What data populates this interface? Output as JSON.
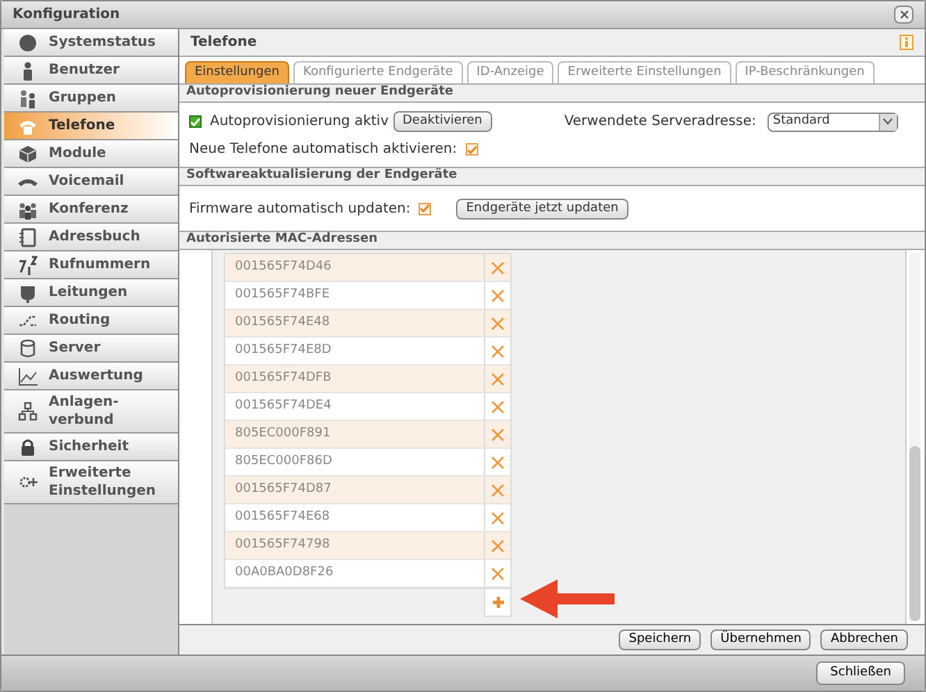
{
  "window": {
    "title": "Konfiguration"
  },
  "sidebar": {
    "items": [
      {
        "label": "Systemstatus",
        "selected": false
      },
      {
        "label": "Benutzer",
        "selected": false
      },
      {
        "label": "Gruppen",
        "selected": false
      },
      {
        "label": "Telefone",
        "selected": true
      },
      {
        "label": "Module",
        "selected": false
      },
      {
        "label": "Voicemail",
        "selected": false
      },
      {
        "label": "Konferenz",
        "selected": false
      },
      {
        "label": "Adressbuch",
        "selected": false
      },
      {
        "label": "Rufnummern",
        "selected": false
      },
      {
        "label": "Leitungen",
        "selected": false
      },
      {
        "label": "Routing",
        "selected": false
      },
      {
        "label": "Server",
        "selected": false
      },
      {
        "label": "Auswertung",
        "selected": false
      },
      {
        "label": "Anlagen-\nverbund",
        "selected": false
      },
      {
        "label": "Sicherheit",
        "selected": false
      },
      {
        "label": "Erweiterte\nEinstellungen",
        "selected": false
      }
    ]
  },
  "panel": {
    "title": "Telefone"
  },
  "tabs": [
    {
      "label": "Einstellungen",
      "selected": true
    },
    {
      "label": "Konfigurierte Endgeräte",
      "selected": false
    },
    {
      "label": "ID-Anzeige",
      "selected": false
    },
    {
      "label": "Erweiterte Einstellungen",
      "selected": false
    },
    {
      "label": "IP-Beschränkungen",
      "selected": false
    }
  ],
  "autoprovisioning": {
    "title": "Autoprovisionierung neuer Endgeräte",
    "active": {
      "label": "Autoprovisionierung aktiv",
      "checked": true
    },
    "deactivate_button": "Deaktivieren",
    "server_label": "Verwendete Serveradresse:",
    "server_value": "Standard",
    "auto_activate": {
      "label": "Neue Telefone automatisch aktivieren:",
      "checked": true
    }
  },
  "software_update": {
    "title": "Softwareaktualisierung der Endgeräte",
    "auto_update": {
      "label": "Firmware automatisch updaten:",
      "checked": true
    },
    "update_button": "Endgeräte jetzt updaten"
  },
  "mac_addresses": {
    "title": "Autorisierte MAC-Adressen",
    "rows": [
      "001565F74D46",
      "001565F74BFE",
      "001565F74E48",
      "001565F74E8D",
      "001565F74DFB",
      "001565F74DE4",
      "805EC000F891",
      "805EC000F86D",
      "001565F74D87",
      "001565F74E68",
      "001565F74798",
      "00A0BA0D8F26"
    ]
  },
  "buttons": [
    "Speichern",
    "Übernehmen",
    "Abbrechen"
  ],
  "footer": {
    "close_button": "Schließen"
  }
}
